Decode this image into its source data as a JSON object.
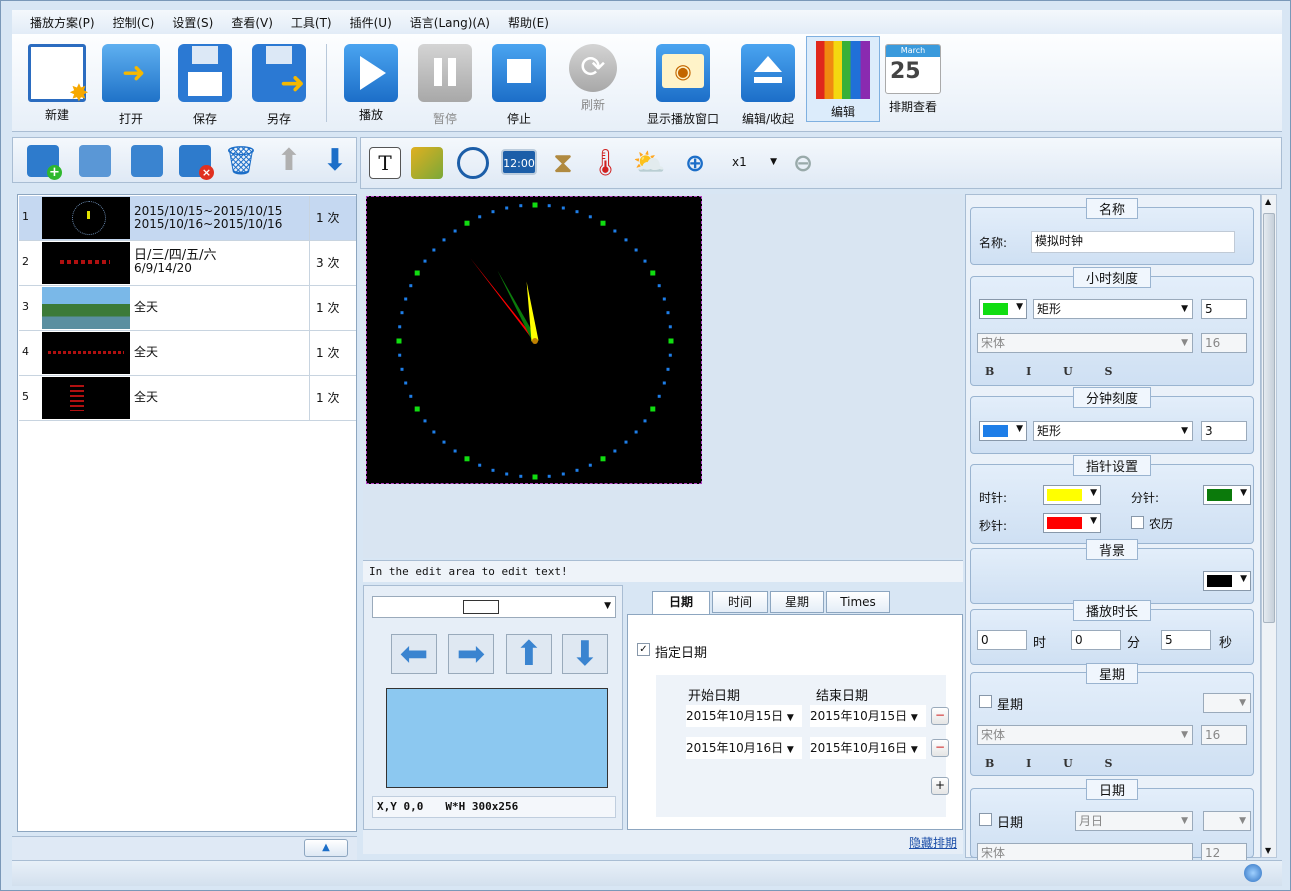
{
  "menu": [
    "播放方案(P)",
    "控制(C)",
    "设置(S)",
    "查看(V)",
    "工具(T)",
    "插件(U)",
    "语言(Lang)(A)",
    "帮助(E)"
  ],
  "toolbar": {
    "new": "新建",
    "open": "打开",
    "save": "保存",
    "save_as": "另存",
    "play": "播放",
    "pause": "暂停",
    "stop": "停止",
    "refresh": "刷新",
    "show_window": "显示播放窗口",
    "edit_collapse": "编辑/收起",
    "edit": "编辑",
    "schedule": "排期查看",
    "calendar_month": "March",
    "calendar_day": "25"
  },
  "program_list": [
    {
      "num": "1",
      "line1": "2015/10/15~2015/10/15",
      "line2": "2015/10/16~2015/10/16",
      "count": "1 次"
    },
    {
      "num": "2",
      "line1": "日/三/四/五/六",
      "line2": "6/9/14/20",
      "count": "3 次"
    },
    {
      "num": "3",
      "line1": "全天",
      "line2": "",
      "count": "1 次"
    },
    {
      "num": "4",
      "line1": "全天",
      "line2": "",
      "count": "1 次"
    },
    {
      "num": "5",
      "line1": "全天",
      "line2": "",
      "count": "1 次"
    }
  ],
  "editor": {
    "zoom": "x1",
    "status_text": "In the edit area to edit text!",
    "coords": "X,Y 0,0",
    "size": "W*H 300x256",
    "hide_schedule": "隐藏排期"
  },
  "tabs": [
    "日期",
    "时间",
    "星期",
    "Times"
  ],
  "date_panel": {
    "checkbox_label": "指定日期",
    "start_header": "开始日期",
    "end_header": "结束日期",
    "rows": [
      {
        "start": "2015年10月15日",
        "end": "2015年10月15日"
      },
      {
        "start": "2015年10月16日",
        "end": "2015年10月16日"
      }
    ],
    "remove": "−",
    "add": "+"
  },
  "props": {
    "name_group": "名称",
    "name_label": "名称:",
    "name_value": "模拟时钟",
    "hour_group": "小时刻度",
    "hour_color": "#11dd11",
    "hour_shape": "矩形",
    "hour_size": "5",
    "font": "宋体",
    "font_size": "16",
    "format_buttons": "B I U S",
    "minute_group": "分钟刻度",
    "minute_color": "#1e7ee8",
    "minute_shape": "矩形",
    "minute_size": "3",
    "hands_group": "指针设置",
    "hour_hand_label": "时针:",
    "hour_hand_color": "#ffff00",
    "minute_hand_label": "分针:",
    "minute_hand_color": "#0b7a0b",
    "second_hand_label": "秒针:",
    "second_hand_color": "#ff0000",
    "lunar_label": "农历",
    "bg_group": "背景",
    "bg_color": "#000000",
    "duration_group": "播放时长",
    "hours": "0",
    "hours_unit": "时",
    "minutes": "0",
    "minutes_unit": "分",
    "seconds": "5",
    "seconds_unit": "秒",
    "week_group": "星期",
    "week_label": "星期",
    "date_group": "日期",
    "date_label": "日期",
    "date_format": "月日",
    "date_font_size": "12"
  }
}
